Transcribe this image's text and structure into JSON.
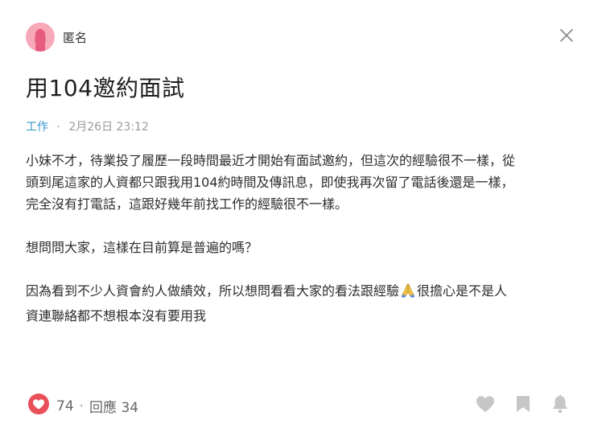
{
  "author": {
    "name": "匿名"
  },
  "post": {
    "title": "用104邀約面試",
    "board": "工作",
    "separator": "·",
    "datetime": "2月26日 23:12",
    "paragraph1_line1": "小妹不才，待業投了履歷一段時間最近才開始有面試邀約，但這次的經驗很不一樣，從",
    "paragraph1_line2": "頭到尾這家的人資都只跟我用104約時間及傳訊息，即使我再次留了電話後還是一樣，",
    "paragraph1_line3": "完全沒有打電話，這跟好幾年前找工作的經驗很不一樣。",
    "paragraph2": "想問問大家，這樣在目前算是普遍的嗎？",
    "paragraph3_line1_a": "因為看到不少人資會約人做績效，所以想問看看大家的看法跟經驗",
    "paragraph3_line1_b": "很擔心是不是人",
    "paragraph3_line2": "資連聯絡都不想根本沒有要用我"
  },
  "stats": {
    "likes": "74",
    "separator": "·",
    "comments": "回應 34"
  },
  "icons": {
    "avatar": "female-avatar-icon",
    "close": "close-icon",
    "reaction": "heart-reaction-icon",
    "emoji": "folded-hands-emoji-icon",
    "like": "heart-icon",
    "bookmark": "bookmark-icon",
    "notify": "bell-icon"
  },
  "colors": {
    "board_link": "#3397cf",
    "reaction_red": "#e9505a",
    "icon_gray": "#c6c6c6",
    "avatar_pink": "#f8a9b9",
    "avatar_figure": "#e75c7c"
  }
}
